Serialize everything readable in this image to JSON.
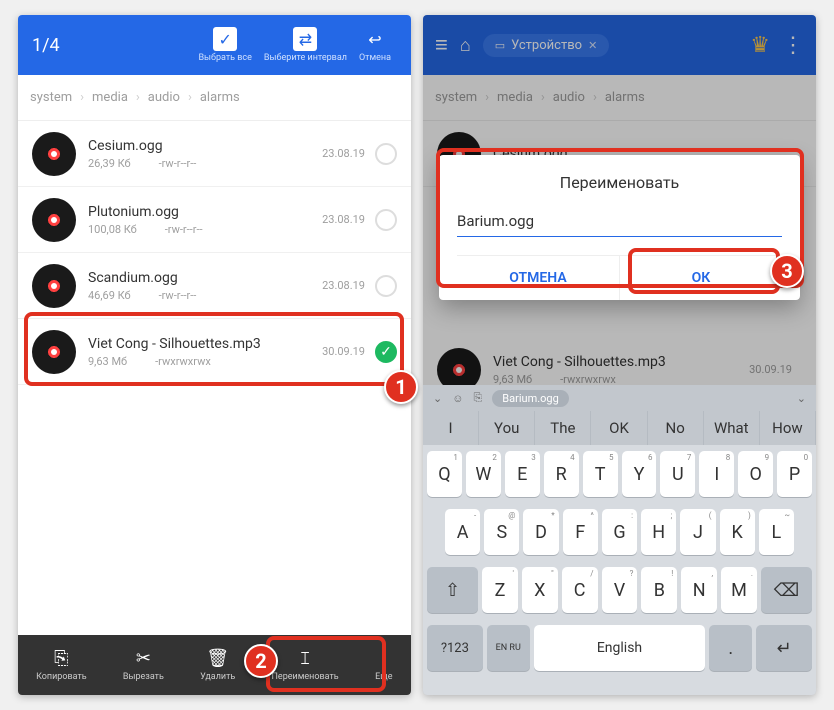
{
  "left": {
    "counter": "1/4",
    "hdr_btns": [
      {
        "icon": "✓",
        "label": "Выбрать все"
      },
      {
        "icon": "⇄",
        "label": "Выберите интервал"
      },
      {
        "icon": "↩",
        "label": "Отмена",
        "plain": true
      }
    ],
    "crumbs": [
      "system",
      "media",
      "audio",
      "alarms"
    ],
    "files": [
      {
        "name": "Cesium.ogg",
        "size": "26,39 Кб",
        "perm": "-rw-r--r--",
        "date": "23.08.19",
        "checked": false
      },
      {
        "name": "Plutonium.ogg",
        "size": "100,08 Кб",
        "perm": "-rw-r--r--",
        "date": "23.08.19",
        "checked": false
      },
      {
        "name": "Scandium.ogg",
        "size": "46,69 Кб",
        "perm": "-rw-r--r--",
        "date": "23.08.19",
        "checked": false
      },
      {
        "name": "Viet Cong - Silhouettes.mp3",
        "size": "9,63 Мб",
        "perm": "-rwxrwxrwx",
        "date": "30.09.19",
        "checked": true
      }
    ],
    "bbar": [
      {
        "icon": "⎘",
        "label": "Копировать"
      },
      {
        "icon": "✂",
        "label": "Вырезать"
      },
      {
        "icon": "🗑",
        "label": "Удалить"
      },
      {
        "icon": "𝙸",
        "label": "Переименовать"
      },
      {
        "icon": "⋮",
        "label": "Еще"
      }
    ]
  },
  "right": {
    "chip": "Устройство",
    "crumbs": [
      "system",
      "media",
      "audio",
      "alarms"
    ],
    "dialog": {
      "title": "Переименовать",
      "value": "Barium.ogg",
      "cancel": "ОТМЕНА",
      "ok": "ОК"
    },
    "bgfile": {
      "name": "Viet Cong - Silhouettes.mp3",
      "size": "9,63 Мб",
      "perm": "-rwxrwxrwx",
      "date": "30.09.19"
    },
    "sugg_pill": "Barium.ogg",
    "sugg": [
      "I",
      "You",
      "The",
      "OK",
      "No",
      "What",
      "How"
    ],
    "rows": [
      [
        [
          "Q",
          "1"
        ],
        [
          "W",
          "2"
        ],
        [
          "E",
          "3"
        ],
        [
          "R",
          "4"
        ],
        [
          "T",
          "5"
        ],
        [
          "Y",
          "6"
        ],
        [
          "U",
          "7"
        ],
        [
          "I",
          "8"
        ],
        [
          "O",
          "9"
        ],
        [
          "P",
          "0"
        ]
      ],
      [
        [
          "A",
          "-"
        ],
        [
          "S",
          "@"
        ],
        [
          "D",
          "*"
        ],
        [
          "F",
          "^"
        ],
        [
          "G",
          ":"
        ],
        [
          "H",
          ";"
        ],
        [
          "J",
          "("
        ],
        [
          "K",
          ")"
        ],
        [
          "L",
          "~"
        ]
      ],
      [
        [
          "Z",
          "'"
        ],
        [
          "X",
          "\""
        ],
        [
          "C",
          "/"
        ],
        [
          "V",
          "?"
        ],
        [
          "B",
          "!"
        ],
        [
          "N",
          ","
        ],
        [
          "M",
          "."
        ]
      ]
    ],
    "bottom": {
      "sym": "?123",
      "lang": "EN RU",
      "space": "English",
      "enter": "↵"
    }
  }
}
